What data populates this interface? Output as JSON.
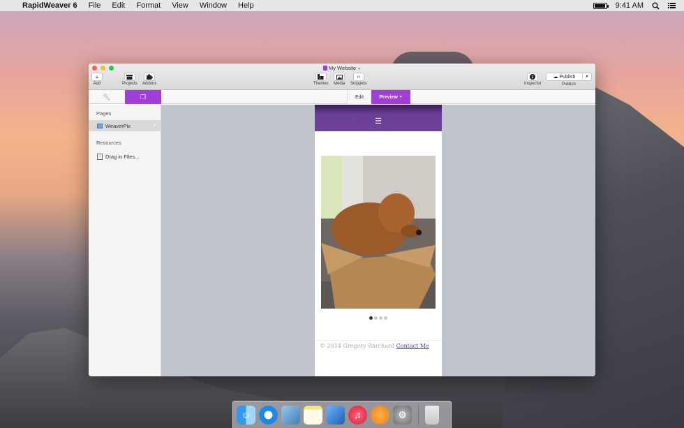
{
  "menubar": {
    "app_name": "RapidWeaver 6",
    "menus": [
      "File",
      "Edit",
      "Format",
      "View",
      "Window",
      "Help"
    ],
    "clock": "9:41 AM"
  },
  "window": {
    "title": "My Website",
    "toolbar": {
      "add": "Add",
      "projects": "Projects",
      "addons": "Addons",
      "themes": "Themes",
      "media": "Media",
      "snippets": "Snippets",
      "inspector": "Inspector",
      "publish_button": "Publish",
      "publish_label": "Publish"
    },
    "modes": {
      "edit": "Edit",
      "preview": "Preview"
    },
    "sidebar": {
      "pages_heading": "Pages",
      "pages": [
        {
          "label": "WeaverPix"
        }
      ],
      "resources_heading": "Resources",
      "resources_drop": "Drag in Files..."
    },
    "preview": {
      "menu_icon": "hamburger-icon",
      "slideshow": {
        "current": 1,
        "total": 4
      },
      "footer_text": "© 2014 Gregory Barchard",
      "footer_link": "Contact Me"
    }
  },
  "colors": {
    "accent_purple": "#a13ed8",
    "header_purple": "#6d429a",
    "link_purple": "#6b2fa0"
  },
  "dock": {
    "apps": [
      "finder-icon",
      "safari-icon",
      "preview-icon",
      "notes-icon",
      "xcode-icon",
      "itunes-icon",
      "ibooks-icon",
      "system-preferences-icon",
      "trash-icon"
    ]
  }
}
